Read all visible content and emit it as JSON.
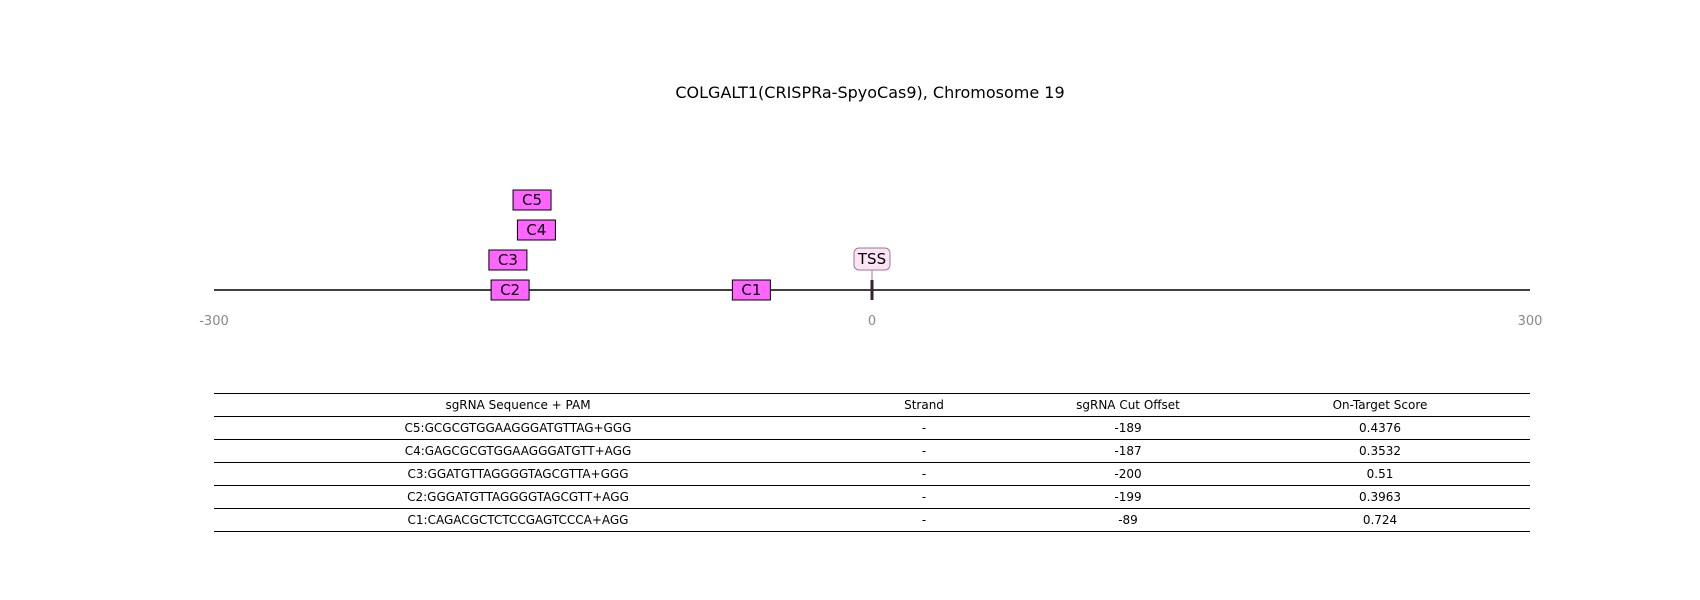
{
  "title": "COLGALT1(CRISPRa-SpyoCas9), Chromosome 19",
  "colors": {
    "guide_fill": "#ff66ff",
    "tss_fill": "#fde3f4",
    "tss_stroke": "#9b7a94",
    "axis": "#000000",
    "tick_text": "#888888"
  },
  "axis": {
    "range": [
      -300,
      300
    ],
    "ticks": [
      {
        "value": -300,
        "label": "-300"
      },
      {
        "value": 0,
        "label": "0"
      },
      {
        "value": 300,
        "label": "300"
      }
    ]
  },
  "tss": {
    "label": "TSS",
    "position": 0
  },
  "guides": [
    {
      "label": "C5",
      "center": -155,
      "row": 3
    },
    {
      "label": "C4",
      "center": -153,
      "row": 2
    },
    {
      "label": "C3",
      "center": -166,
      "row": 1
    },
    {
      "label": "C2",
      "center": -165,
      "row": 0
    },
    {
      "label": "C1",
      "center": -55,
      "row": 0
    }
  ],
  "table": {
    "headers": [
      "sgRNA Sequence + PAM",
      "Strand",
      "sgRNA Cut Offset",
      "On-Target Score"
    ],
    "rows": [
      [
        "C5:GCGCGTGGAAGGGATGTTAG+GGG",
        "-",
        "-189",
        "0.4376"
      ],
      [
        "C4:GAGCGCGTGGAAGGGATGTT+AGG",
        "-",
        "-187",
        "0.3532"
      ],
      [
        "C3:GGATGTTAGGGGTAGCGTTA+GGG",
        "-",
        "-200",
        "0.51"
      ],
      [
        "C2:GGGATGTTAGGGGTAGCGTT+AGG",
        "-",
        "-199",
        "0.3963"
      ],
      [
        "C1:CAGACGCTCTCCGAGTCCCA+AGG",
        "-",
        "-89",
        "0.724"
      ]
    ]
  }
}
